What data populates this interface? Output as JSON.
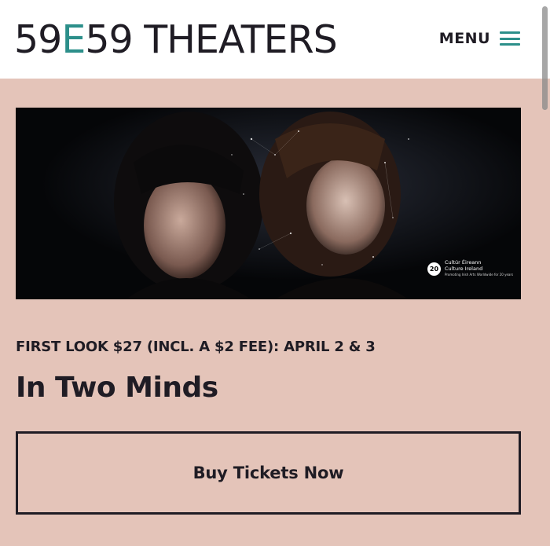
{
  "header": {
    "logo_prefix": "59",
    "logo_accent": "E",
    "logo_suffix": "59 THEATERS",
    "menu_label": "MENU"
  },
  "hero": {
    "badge_mark": "20",
    "badge_line1": "Cultúr Éireann",
    "badge_line2": "Culture Ireland",
    "badge_line3": "Promoting Irish Arts Worldwide for 20 years"
  },
  "show": {
    "subtitle": "FIRST LOOK $27 (INCL. A $2 FEE): APRIL 2 & 3",
    "title": "In Two Minds",
    "buy_label": "Buy Tickets Now"
  },
  "colors": {
    "accent": "#2c8f8a",
    "background": "#e4c4b9",
    "text": "#1f1c24"
  }
}
